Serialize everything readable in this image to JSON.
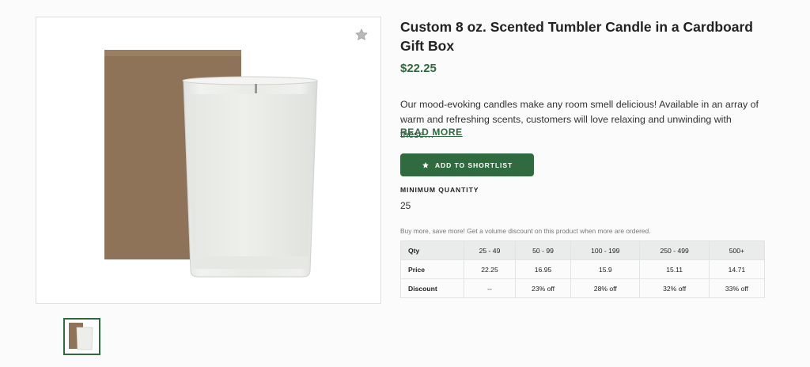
{
  "product": {
    "title": "Custom 8 oz. Scented Tumbler Candle in a Cardboard Gift Box",
    "price": "$22.25",
    "description": "Our mood-evoking candles make any room smell delicious! Available in an array of warm and refreshing scents, customers will love relaxing and unwinding with these…",
    "read_more_label": "READ MORE",
    "shortlist_label": "ADD TO SHORTLIST",
    "min_quantity_label": "MINIMUM QUANTITY",
    "min_quantity_value": "25",
    "volume_note": "Buy more, save more! Get a volume discount on this product when more are ordered."
  },
  "pricing_table": {
    "header": [
      "Qty",
      "25 - 49",
      "50 - 99",
      "100 - 199",
      "250 - 499",
      "500+"
    ],
    "rows": [
      [
        "Price",
        "22.25",
        "16.95",
        "15.9",
        "15.11",
        "14.71"
      ],
      [
        "Discount",
        "--",
        "23% off",
        "28% off",
        "32% off",
        "33% off"
      ]
    ]
  },
  "icons": {
    "favorite": "star-icon",
    "shortlist": "star-icon"
  },
  "colors": {
    "brand_green": "#2f6b3e",
    "table_header_bg": "#e9ecea",
    "kraft_box": "#8e7358"
  }
}
